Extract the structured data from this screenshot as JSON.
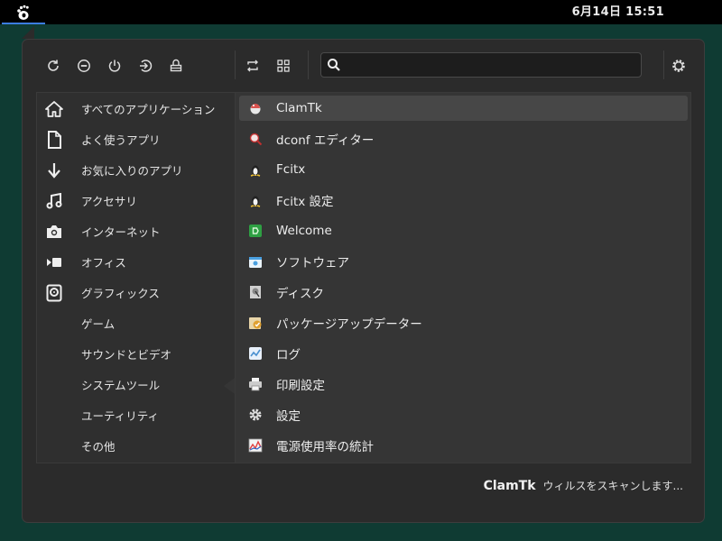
{
  "topbar": {
    "activities_icon": "gnome-foot-icon",
    "clock": "6月14日  15:51"
  },
  "toolbar": {
    "buttons": [
      {
        "name": "refresh-icon"
      },
      {
        "name": "lock-icon"
      },
      {
        "name": "power-icon"
      },
      {
        "name": "logout-icon"
      },
      {
        "name": "hibernate-icon"
      },
      {
        "name": "switch-view-icon"
      },
      {
        "name": "grid-view-icon"
      }
    ],
    "search_placeholder": "",
    "search_value": "",
    "settings_icon": "gear-icon"
  },
  "sidebar_icons": [
    "home-icon",
    "document-icon",
    "download-icon",
    "music-icon",
    "camera-icon",
    "video-icon",
    "drive-icon"
  ],
  "categories": [
    "すべてのアプリケーション",
    "よく使うアプリ",
    "お気に入りのアプリ",
    "アクセサリ",
    "インターネット",
    "オフィス",
    "グラフィックス",
    "ゲーム",
    "サウンドとビデオ",
    "システムツール",
    "ユーティリティ",
    "その他"
  ],
  "active_category": "システムツール",
  "apps": [
    {
      "label": "ClamTk",
      "icon": "clamtk-icon",
      "color": "#d9534f",
      "selected": true
    },
    {
      "label": "dconf エディター",
      "icon": "dconf-icon",
      "color": "#c03030"
    },
    {
      "label": "Fcitx",
      "icon": "penguin-icon",
      "color": "#f0c030"
    },
    {
      "label": "Fcitx 設定",
      "icon": "penguin-icon",
      "color": "#f0c030"
    },
    {
      "label": "Welcome",
      "icon": "welcome-icon",
      "color": "#2ea043"
    },
    {
      "label": "ソフトウェア",
      "icon": "software-icon",
      "color": "#4aa0e0"
    },
    {
      "label": "ディスク",
      "icon": "disks-icon",
      "color": "#aaaaaa"
    },
    {
      "label": "パッケージアップデーター",
      "icon": "updater-icon",
      "color": "#e0a030"
    },
    {
      "label": "ログ",
      "icon": "logs-icon",
      "color": "#4a90d0"
    },
    {
      "label": "印刷設定",
      "icon": "printer-icon",
      "color": "#cccccc"
    },
    {
      "label": "設定",
      "icon": "settings-gear-icon",
      "color": "#dddddd"
    },
    {
      "label": "電源使用率の統計",
      "icon": "power-stats-icon",
      "color": "#e04040"
    }
  ],
  "footer": {
    "app_name": "ClamTk",
    "description": "ウィルスをスキャンします..."
  },
  "colors": {
    "desktop": "#0f3b33",
    "menu_bg": "#2b2b2b",
    "selected_row": "#474747",
    "focus_accent": "#3b7de0"
  }
}
